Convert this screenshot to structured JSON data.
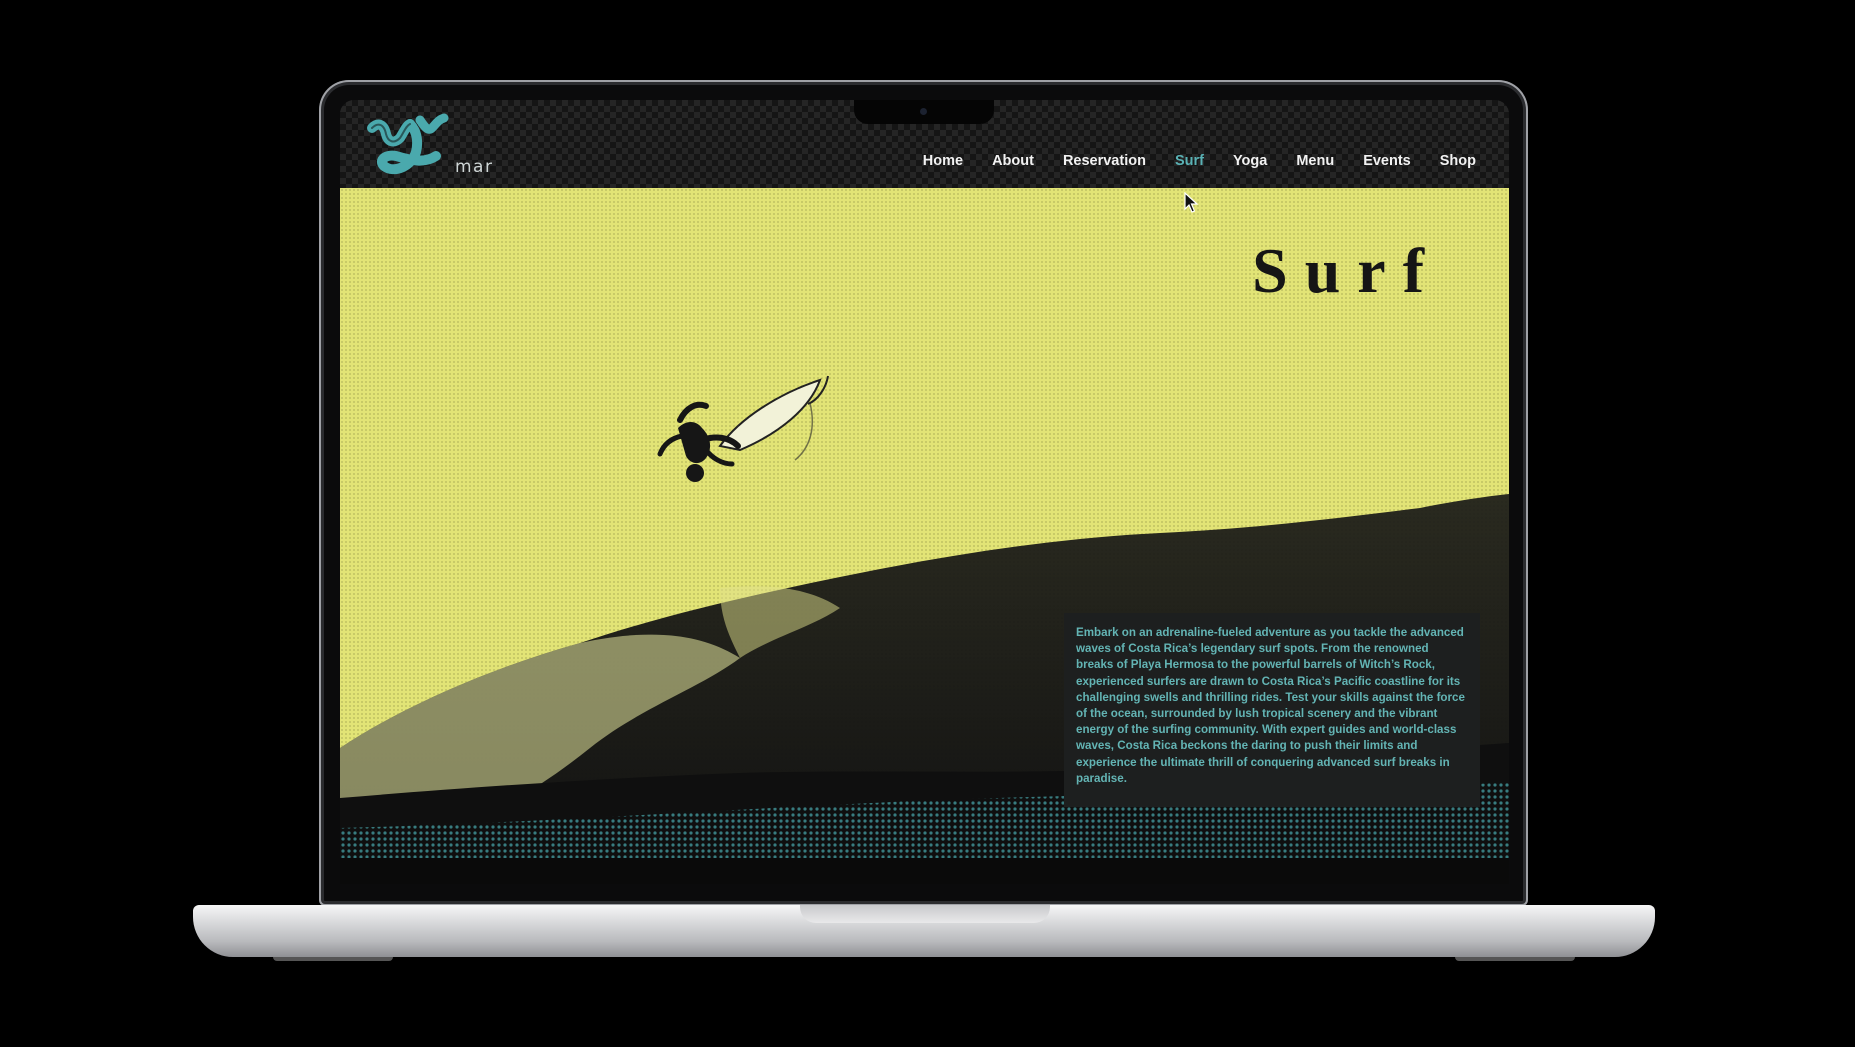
{
  "logo": {
    "mark": "y",
    "text": "mar"
  },
  "nav": {
    "items": [
      {
        "label": "Home"
      },
      {
        "label": "About"
      },
      {
        "label": "Reservation"
      },
      {
        "label": "Surf"
      },
      {
        "label": "Yoga"
      },
      {
        "label": "Menu"
      },
      {
        "label": "Events"
      },
      {
        "label": "Shop"
      }
    ],
    "active": "Surf"
  },
  "hero": {
    "title": "Surf",
    "description": "Embark on an adrenaline-fueled adventure as you tackle the advanced waves of Costa Rica’s legendary surf spots. From the renowned breaks of Playa Hermosa to the powerful barrels of Witch’s Rock, experienced surfers are drawn to Costa Rica’s Pacific coastline for its challenging swells and thrilling rides. Test your skills against the force of the ocean, surrounded by lush tropical scenery and the vibrant energy of the surfing community. With expert guides and world-class waves, Costa Rica beckons the daring to push their limits and experience the ultimate thrill of conquering advanced surf breaks in paradise."
  },
  "colors": {
    "accent": "#5ab2b5",
    "hero_background": "#e2e476",
    "text_panel": "#1d1f1f",
    "nav_text": "#f2f2f2"
  },
  "icons": {
    "pointer": "arrow-cursor-icon"
  }
}
